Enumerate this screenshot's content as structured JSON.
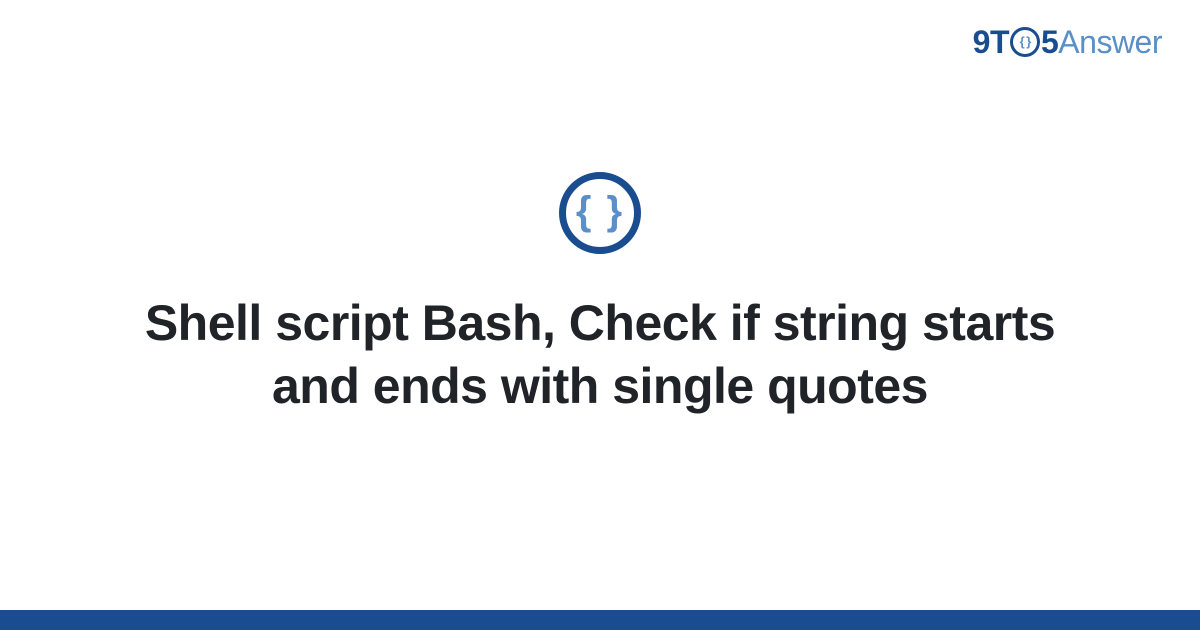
{
  "logo": {
    "part1": "9T",
    "circle_inner": "{ }",
    "part2": "5",
    "part3": "Answer"
  },
  "icon": {
    "braces": "{ }"
  },
  "heading": "Shell script Bash, Check if string starts and ends with single quotes"
}
